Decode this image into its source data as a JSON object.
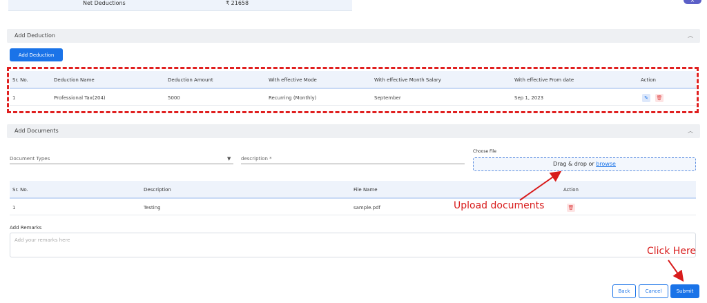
{
  "summary": {
    "net_deductions_label": "Net Deductions",
    "net_deductions_value": "₹ 21658"
  },
  "close_label": "×",
  "deduction_section": {
    "title": "Add Deduction",
    "add_button": "Add Deduction",
    "columns": [
      "Sr. No.",
      "Deduction Name",
      "Deduction Amount",
      "With effective Mode",
      "With effective Month Salary",
      "With effective From date",
      "Action"
    ],
    "rows": [
      {
        "sr": "1",
        "name": "Professional Tax(204)",
        "amount": "5000",
        "mode": "Recurring (Monthly)",
        "month": "September",
        "from_date": "Sep 1, 2023"
      }
    ]
  },
  "documents_section": {
    "title": "Add Documents",
    "document_types_placeholder": "Document Types",
    "description_placeholder": "description *",
    "choose_file_label": "Choose File",
    "drop_text": "Drag & drop or ",
    "browse_text": "browse",
    "columns": [
      "Sr. No.",
      "Description",
      "File Name",
      "Action"
    ],
    "rows": [
      {
        "sr": "1",
        "description": "Testing",
        "file_name": "sample.pdf"
      }
    ]
  },
  "remarks": {
    "label": "Add Remarks",
    "placeholder": "Add your remarks here"
  },
  "footer": {
    "back": "Back",
    "cancel": "Cancel",
    "submit": "Submit"
  },
  "annotations": {
    "upload": "Upload documents",
    "click": "Click Here"
  },
  "colors": {
    "primary": "#1a73e8",
    "annotation": "#d81b1b",
    "delete": "#e04848"
  },
  "icons": {
    "edit": "edit-icon",
    "delete": "trash-icon",
    "chevron": "chevron-up-icon",
    "dropdown": "caret-down-icon"
  }
}
